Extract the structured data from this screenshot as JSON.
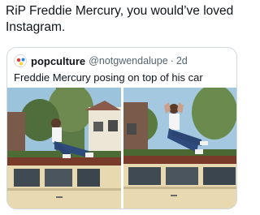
{
  "tweet": {
    "text": "RiP Freddie Mercury, you would’ve loved Instagram."
  },
  "quote": {
    "name": "popculture",
    "handle": "@notgwendalupe",
    "separator": "·",
    "time": "2d",
    "text": "Freddie Mercury posing on top of his car",
    "avatar_icon": "popculture-logo-icon",
    "photos": [
      {
        "name": "photo-left",
        "icon": "man-on-car-photo"
      },
      {
        "name": "photo-right",
        "icon": "man-on-car-photo"
      }
    ]
  },
  "colors": {
    "text": "#0f1419",
    "secondary": "#536471",
    "border": "#cfd9de",
    "car": "#e8d9b0",
    "roof": "#7a3a2a"
  }
}
